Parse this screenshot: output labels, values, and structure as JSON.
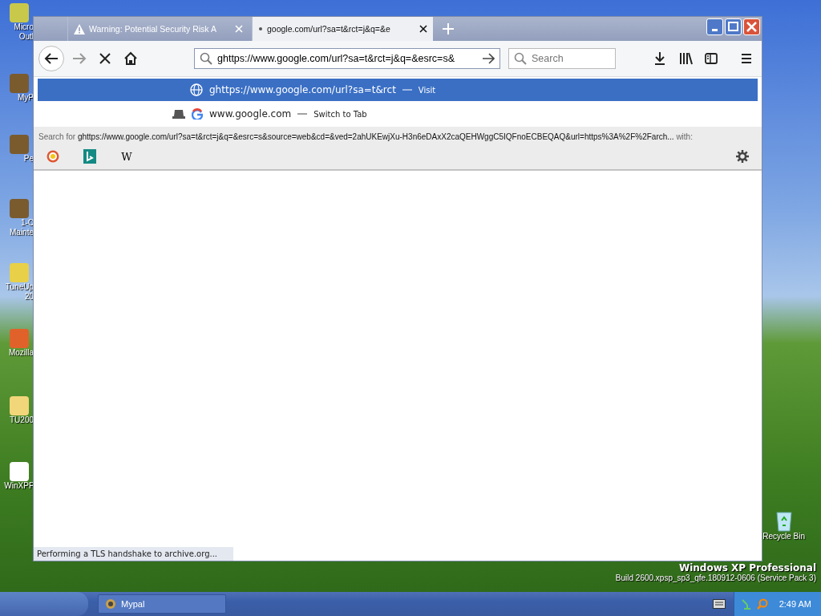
{
  "desktop_icons": [
    {
      "lines": [
        "Micro",
        "Outl"
      ],
      "kind": "outlook"
    },
    {
      "lines": [
        "MyP"
      ],
      "kind": "app"
    },
    {
      "lines": [
        "Pe"
      ],
      "kind": "app"
    },
    {
      "lines": [
        "1-C",
        "Mainte"
      ],
      "kind": "app"
    },
    {
      "lines": [
        "TuneUp",
        "20"
      ],
      "kind": "tool"
    },
    {
      "lines": [
        "Mozilla"
      ],
      "kind": "browser"
    },
    {
      "lines": [
        "TU200"
      ],
      "kind": "folder"
    },
    {
      "lines": [
        "WinXPF"
      ],
      "kind": "doc"
    }
  ],
  "browser": {
    "tabs": [
      {
        "title": "Warning: Potential Security Risk A",
        "selected": false,
        "kind": "warning"
      },
      {
        "title": "google.com/url?sa=t&rct=j&q=&e",
        "selected": true,
        "kind": "loading"
      }
    ],
    "url_field": {
      "value": "ghttps://www.google.com/url?sa=t&rct=j&q=&esrc=s&"
    },
    "search_field": {
      "placeholder": "Search"
    },
    "suggestions": [
      {
        "kind": "visit",
        "text": "ghttps://www.google.com/url?sa=t&rct",
        "action": "Visit",
        "selected": true
      },
      {
        "kind": "tab",
        "text": "www.google.com",
        "action": "Switch to Tab",
        "selected": false
      }
    ],
    "search_for": {
      "prefix": "Search for",
      "query": "ghttps://www.google.com/url?sa=t&rct=j&q=&esrc=s&source=web&cd=&ved=2ahUKEwjXu-H3n6eDAxX2caQEHWggC5IQFnoECBEQAQ&url=https%3A%2F%2Farch...",
      "suffix": "with:"
    },
    "engines": [
      {
        "kind": "duck"
      },
      {
        "kind": "bing"
      },
      {
        "kind": "wiki",
        "label": "W"
      }
    ],
    "status": "Performing a TLS handshake to archive.org..."
  },
  "recycle_bin": "Recycle Bin",
  "os_label": {
    "title": "Windows XP Professional",
    "build": "Build 2600.xpsp_sp3_qfe.180912-0606 (Service Pack 3)"
  },
  "taskbar": {
    "tasks": [
      {
        "label": "Mypal"
      }
    ],
    "clock": "2:49 AM"
  }
}
